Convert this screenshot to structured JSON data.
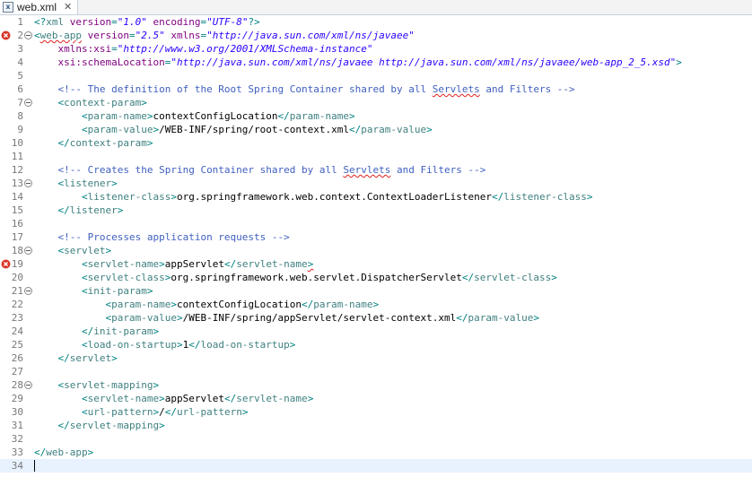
{
  "tab": {
    "title": "web.xml",
    "icon": "xml-file-icon",
    "close_icon": "close-icon"
  },
  "colors": {
    "tag": "#3f7f7f",
    "attribute": "#7f007f",
    "value": "#2a00ff",
    "comment": "#3f5fbf",
    "punctuation": "#008080",
    "text": "#000000",
    "error": "#e02020",
    "current_line": "#e8f2fe"
  },
  "editor": {
    "lines": [
      {
        "n": "1",
        "tokens": [
          {
            "t": "pun",
            "s": "<?"
          },
          {
            "t": "tag",
            "s": "xml "
          },
          {
            "t": "att",
            "s": "version"
          },
          {
            "t": "pun",
            "s": "="
          },
          {
            "t": "val",
            "s": "\"1.0\""
          },
          {
            "t": "txt",
            "s": " "
          },
          {
            "t": "att",
            "s": "encoding"
          },
          {
            "t": "pun",
            "s": "="
          },
          {
            "t": "val",
            "s": "\"UTF-8\""
          },
          {
            "t": "pun",
            "s": "?>"
          }
        ]
      },
      {
        "n": "2",
        "error": true,
        "fold": true,
        "tokens": [
          {
            "t": "pun",
            "s": "<"
          },
          {
            "t": "tag",
            "s": "web-app",
            "sq": true
          },
          {
            "t": "txt",
            "s": " "
          },
          {
            "t": "att",
            "s": "version"
          },
          {
            "t": "pun",
            "s": "="
          },
          {
            "t": "val",
            "s": "\"2.5\""
          },
          {
            "t": "txt",
            "s": " "
          },
          {
            "t": "att",
            "s": "xmlns"
          },
          {
            "t": "pun",
            "s": "="
          },
          {
            "t": "val",
            "s": "\"http://java.sun.com/xml/ns/javaee\""
          }
        ]
      },
      {
        "n": "3",
        "tokens": [
          {
            "t": "txt",
            "s": "    "
          },
          {
            "t": "att",
            "s": "xmlns:xsi"
          },
          {
            "t": "pun",
            "s": "="
          },
          {
            "t": "val",
            "s": "\"http://www.w3.org/2001/XMLSchema-instance\""
          }
        ]
      },
      {
        "n": "4",
        "tokens": [
          {
            "t": "txt",
            "s": "    "
          },
          {
            "t": "att",
            "s": "xsi:schemaLocation"
          },
          {
            "t": "pun",
            "s": "="
          },
          {
            "t": "val",
            "s": "\"http://java.sun.com/xml/ns/javaee http://java.sun.com/xml/ns/javaee/web-app_2_5.xsd\""
          },
          {
            "t": "pun",
            "s": ">"
          }
        ]
      },
      {
        "n": "5",
        "tokens": []
      },
      {
        "n": "6",
        "tokens": [
          {
            "t": "txt",
            "s": "    "
          },
          {
            "t": "cm",
            "s": "<!-- The definition of the Root Spring Container shared by all "
          },
          {
            "t": "cm",
            "s": "Servlets",
            "sq": true
          },
          {
            "t": "cm",
            "s": " and Filters -->"
          }
        ]
      },
      {
        "n": "7",
        "fold": true,
        "tokens": [
          {
            "t": "txt",
            "s": "    "
          },
          {
            "t": "pun",
            "s": "<"
          },
          {
            "t": "tag",
            "s": "context-param"
          },
          {
            "t": "pun",
            "s": ">"
          }
        ]
      },
      {
        "n": "8",
        "tokens": [
          {
            "t": "txt",
            "s": "        "
          },
          {
            "t": "pun",
            "s": "<"
          },
          {
            "t": "tag",
            "s": "param-name"
          },
          {
            "t": "pun",
            "s": ">"
          },
          {
            "t": "txt",
            "s": "contextConfigLocation"
          },
          {
            "t": "pun",
            "s": "</"
          },
          {
            "t": "tag",
            "s": "param-name"
          },
          {
            "t": "pun",
            "s": ">"
          }
        ]
      },
      {
        "n": "9",
        "tokens": [
          {
            "t": "txt",
            "s": "        "
          },
          {
            "t": "pun",
            "s": "<"
          },
          {
            "t": "tag",
            "s": "param-value"
          },
          {
            "t": "pun",
            "s": ">"
          },
          {
            "t": "txt",
            "s": "/WEB-INF/spring/root-context.xml"
          },
          {
            "t": "pun",
            "s": "</"
          },
          {
            "t": "tag",
            "s": "param-value"
          },
          {
            "t": "pun",
            "s": ">"
          }
        ]
      },
      {
        "n": "10",
        "tokens": [
          {
            "t": "txt",
            "s": "    "
          },
          {
            "t": "pun",
            "s": "</"
          },
          {
            "t": "tag",
            "s": "context-param"
          },
          {
            "t": "pun",
            "s": ">"
          }
        ]
      },
      {
        "n": "11",
        "tokens": []
      },
      {
        "n": "12",
        "tokens": [
          {
            "t": "txt",
            "s": "    "
          },
          {
            "t": "cm",
            "s": "<!-- Creates the Spring Container shared by all "
          },
          {
            "t": "cm",
            "s": "Servlets",
            "sq": true
          },
          {
            "t": "cm",
            "s": " and Filters -->"
          }
        ]
      },
      {
        "n": "13",
        "fold": true,
        "tokens": [
          {
            "t": "txt",
            "s": "    "
          },
          {
            "t": "pun",
            "s": "<"
          },
          {
            "t": "tag",
            "s": "listener"
          },
          {
            "t": "pun",
            "s": ">"
          }
        ]
      },
      {
        "n": "14",
        "tokens": [
          {
            "t": "txt",
            "s": "        "
          },
          {
            "t": "pun",
            "s": "<"
          },
          {
            "t": "tag",
            "s": "listener-class"
          },
          {
            "t": "pun",
            "s": ">"
          },
          {
            "t": "txt",
            "s": "org.springframework.web.context.ContextLoaderListener"
          },
          {
            "t": "pun",
            "s": "</"
          },
          {
            "t": "tag",
            "s": "listener-class"
          },
          {
            "t": "pun",
            "s": ">"
          }
        ]
      },
      {
        "n": "15",
        "tokens": [
          {
            "t": "txt",
            "s": "    "
          },
          {
            "t": "pun",
            "s": "</"
          },
          {
            "t": "tag",
            "s": "listener"
          },
          {
            "t": "pun",
            "s": ">"
          }
        ]
      },
      {
        "n": "16",
        "tokens": []
      },
      {
        "n": "17",
        "tokens": [
          {
            "t": "txt",
            "s": "    "
          },
          {
            "t": "cm",
            "s": "<!-- Processes application requests -->"
          }
        ]
      },
      {
        "n": "18",
        "fold": true,
        "tokens": [
          {
            "t": "txt",
            "s": "    "
          },
          {
            "t": "pun",
            "s": "<"
          },
          {
            "t": "tag",
            "s": "servlet"
          },
          {
            "t": "pun",
            "s": ">"
          }
        ]
      },
      {
        "n": "19",
        "error": true,
        "tokens": [
          {
            "t": "txt",
            "s": "        "
          },
          {
            "t": "pun",
            "s": "<"
          },
          {
            "t": "tag",
            "s": "servlet-name"
          },
          {
            "t": "pun",
            "s": ">"
          },
          {
            "t": "txt",
            "s": "appServlet"
          },
          {
            "t": "pun",
            "s": "</"
          },
          {
            "t": "tag",
            "s": "servlet-name"
          },
          {
            "t": "pun",
            "s": ">",
            "sq": true
          }
        ]
      },
      {
        "n": "20",
        "tokens": [
          {
            "t": "txt",
            "s": "        "
          },
          {
            "t": "pun",
            "s": "<"
          },
          {
            "t": "tag",
            "s": "servlet-class"
          },
          {
            "t": "pun",
            "s": ">"
          },
          {
            "t": "txt",
            "s": "org.springframework.web.servlet.DispatcherServlet"
          },
          {
            "t": "pun",
            "s": "</"
          },
          {
            "t": "tag",
            "s": "servlet-class"
          },
          {
            "t": "pun",
            "s": ">"
          }
        ]
      },
      {
        "n": "21",
        "fold": true,
        "tokens": [
          {
            "t": "txt",
            "s": "        "
          },
          {
            "t": "pun",
            "s": "<"
          },
          {
            "t": "tag",
            "s": "init-param"
          },
          {
            "t": "pun",
            "s": ">"
          }
        ]
      },
      {
        "n": "22",
        "tokens": [
          {
            "t": "txt",
            "s": "            "
          },
          {
            "t": "pun",
            "s": "<"
          },
          {
            "t": "tag",
            "s": "param-name"
          },
          {
            "t": "pun",
            "s": ">"
          },
          {
            "t": "txt",
            "s": "contextConfigLocation"
          },
          {
            "t": "pun",
            "s": "</"
          },
          {
            "t": "tag",
            "s": "param-name"
          },
          {
            "t": "pun",
            "s": ">"
          }
        ]
      },
      {
        "n": "23",
        "tokens": [
          {
            "t": "txt",
            "s": "            "
          },
          {
            "t": "pun",
            "s": "<"
          },
          {
            "t": "tag",
            "s": "param-value"
          },
          {
            "t": "pun",
            "s": ">"
          },
          {
            "t": "txt",
            "s": "/WEB-INF/spring/appServlet/servlet-context.xml"
          },
          {
            "t": "pun",
            "s": "</"
          },
          {
            "t": "tag",
            "s": "param-value"
          },
          {
            "t": "pun",
            "s": ">"
          }
        ]
      },
      {
        "n": "24",
        "tokens": [
          {
            "t": "txt",
            "s": "        "
          },
          {
            "t": "pun",
            "s": "</"
          },
          {
            "t": "tag",
            "s": "init-param"
          },
          {
            "t": "pun",
            "s": ">"
          }
        ]
      },
      {
        "n": "25",
        "tokens": [
          {
            "t": "txt",
            "s": "        "
          },
          {
            "t": "pun",
            "s": "<"
          },
          {
            "t": "tag",
            "s": "load-on-startup"
          },
          {
            "t": "pun",
            "s": ">"
          },
          {
            "t": "txt",
            "s": "1"
          },
          {
            "t": "pun",
            "s": "</"
          },
          {
            "t": "tag",
            "s": "load-on-startup"
          },
          {
            "t": "pun",
            "s": ">"
          }
        ]
      },
      {
        "n": "26",
        "tokens": [
          {
            "t": "txt",
            "s": "    "
          },
          {
            "t": "pun",
            "s": "</"
          },
          {
            "t": "tag",
            "s": "servlet"
          },
          {
            "t": "pun",
            "s": ">"
          }
        ]
      },
      {
        "n": "27",
        "tokens": []
      },
      {
        "n": "28",
        "fold": true,
        "tokens": [
          {
            "t": "txt",
            "s": "    "
          },
          {
            "t": "pun",
            "s": "<"
          },
          {
            "t": "tag",
            "s": "servlet-mapping"
          },
          {
            "t": "pun",
            "s": ">"
          }
        ]
      },
      {
        "n": "29",
        "tokens": [
          {
            "t": "txt",
            "s": "        "
          },
          {
            "t": "pun",
            "s": "<"
          },
          {
            "t": "tag",
            "s": "servlet-name"
          },
          {
            "t": "pun",
            "s": ">"
          },
          {
            "t": "txt",
            "s": "appServlet"
          },
          {
            "t": "pun",
            "s": "</"
          },
          {
            "t": "tag",
            "s": "servlet-name"
          },
          {
            "t": "pun",
            "s": ">"
          }
        ]
      },
      {
        "n": "30",
        "tokens": [
          {
            "t": "txt",
            "s": "        "
          },
          {
            "t": "pun",
            "s": "<"
          },
          {
            "t": "tag",
            "s": "url-pattern"
          },
          {
            "t": "pun",
            "s": ">"
          },
          {
            "t": "txt",
            "s": "/"
          },
          {
            "t": "pun",
            "s": "</"
          },
          {
            "t": "tag",
            "s": "url-pattern"
          },
          {
            "t": "pun",
            "s": ">"
          }
        ]
      },
      {
        "n": "31",
        "tokens": [
          {
            "t": "txt",
            "s": "    "
          },
          {
            "t": "pun",
            "s": "</"
          },
          {
            "t": "tag",
            "s": "servlet-mapping"
          },
          {
            "t": "pun",
            "s": ">"
          }
        ]
      },
      {
        "n": "32",
        "tokens": []
      },
      {
        "n": "33",
        "tokens": [
          {
            "t": "pun",
            "s": "</"
          },
          {
            "t": "tag",
            "s": "web-app"
          },
          {
            "t": "pun",
            "s": ">"
          }
        ]
      },
      {
        "n": "34",
        "current": true,
        "tokens": []
      }
    ]
  }
}
